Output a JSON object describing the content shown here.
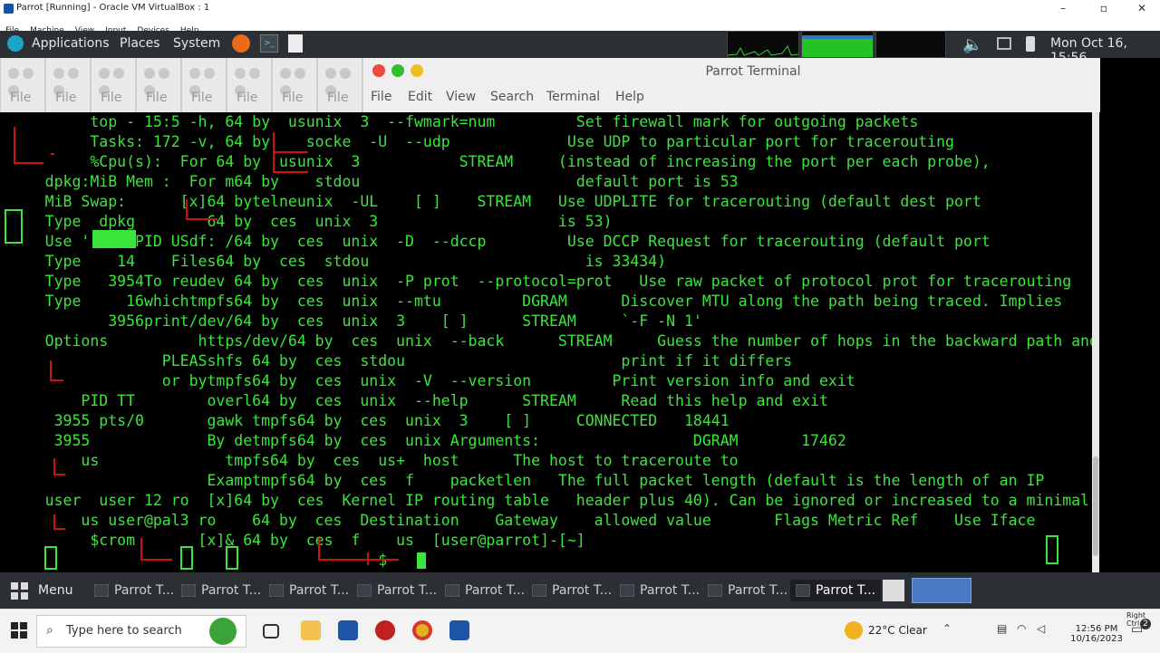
{
  "vbox": {
    "title": "Parrot [Running] - Oracle VM VirtualBox : 1",
    "menu": [
      "File",
      "Machine",
      "View",
      "Input",
      "Devices",
      "Help"
    ]
  },
  "top_panel": {
    "applications": "Applications",
    "places": "Places",
    "system": "System",
    "clock": "Mon Oct 16, 15:56"
  },
  "terminal_window": {
    "title": "Parrot Terminal",
    "menu": [
      "File",
      "Edit",
      "View",
      "Search",
      "Terminal",
      "Help"
    ],
    "background_tab_label": "File"
  },
  "terminal": {
    "lines": [
      {
        "bg": "",
        "fg": "          top - 15:5 -h, 64 by  usunix  3  --fwmark=num         Set firewall mark for outgoing packets"
      },
      {
        "bg": "",
        "fg": "          Tasks: 172 -v, 64 by    socke  -U  --udp             Use UDP to particular port for tracerouting"
      },
      {
        "bg": "",
        "fg": "          %Cpu(s):  For 64 by  usunix  3           STREAM     (instead of increasing the port per each probe),"
      },
      {
        "bg": "",
        "fg": "     dpkg:MiB Mem :  For m64 by    stdou                        default port is 53"
      },
      {
        "bg": "",
        "fg": "     MiB Swap:      [x]64 bytelneunix  -UL    [ ]    STREAM   Use UDPLITE for tracerouting (default dest port"
      },
      {
        "bg": "",
        "fg": "     Type  dpkg        64 by  ces  unix  3                    is 53)"
      },
      {
        "bg": "",
        "fg": "     Use '     PID USdf: /64 by  ces  unix  -D  --dccp         Use DCCP Request for tracerouting (default port"
      },
      {
        "bg": "",
        "fg": "     Type    14    Files64 by  ces  stdou                        is 33434)"
      },
      {
        "bg": "",
        "fg": "     Type   3954To reudev 64 by  ces  unix  -P prot  --protocol=prot   Use raw packet of protocol prot for tracerouting"
      },
      {
        "bg": "",
        "fg": "     Type     16whichtmpfs64 by  ces  unix  --mtu         DGRAM      Discover MTU along the path being traced. Implies"
      },
      {
        "bg": "",
        "fg": "            3956print/dev/64 by  ces  unix  3    [ ]      STREAM     `-F -N 1'"
      },
      {
        "bg": "",
        "fg": "     Options          https/dev/64 by  ces  unix  --back      STREAM     Guess the number of hops in the backward path and"
      },
      {
        "bg": "",
        "fg": "                  PLEASshfs 64 by  ces  stdou                        print if it differs"
      },
      {
        "bg": "",
        "fg": "                  or bytmpfs64 by  ces  unix  -V  --version         Print version info and exit"
      },
      {
        "bg": "",
        "fg": "         PID TT        overl64 by  ces  unix  --help      STREAM     Read this help and exit"
      },
      {
        "bg": "",
        "fg": "      3955 pts/0       gawk tmpfs64 by  ces  unix  3    [ ]     CONNECTED   18441"
      },
      {
        "bg": "",
        "fg": "      3955             By detmpfs64 by  ces  unix Arguments:                 DGRAM       17462"
      },
      {
        "bg": "",
        "fg": "         us              tmpfs64 by  ces  us+  host      The host to traceroute to"
      },
      {
        "bg": "",
        "fg": "                       Examptmpfs64 by  ces  f    packetlen   The full packet length (default is the length of an IP"
      },
      {
        "bg": "",
        "fg": "     user  user 12 ro  [x]64 by  ces  Kernel IP routing table   header plus 40). Can be ignored or increased to a minimal"
      },
      {
        "bg": "",
        "fg": "         us user@pal3 ro    64 by  ces  Destination    Gateway    allowed value       Flags Metric Ref    Use Iface"
      },
      {
        "bg": "",
        "fg": "          $crom       [x]& 64 by  ces  f    us  [user@parrot]-[~]"
      },
      {
        "bg": "",
        "fg": "                                          $"
      }
    ],
    "prompt_user": "user",
    "prompt_host": "parrot",
    "prompt_dir": "~",
    "prompt_symbol": "$"
  },
  "bottom_panel": {
    "menu": "Menu",
    "tasks": [
      "Parrot T...",
      "Parrot T...",
      "Parrot T...",
      "Parrot T...",
      "Parrot T...",
      "Parrot T...",
      "Parrot T...",
      "Parrot T...",
      "Parrot T..."
    ]
  },
  "windows_taskbar": {
    "search_placeholder": "Type here to search",
    "weather": "22°C  Clear",
    "time": "12:56 PM",
    "date": "10/16/2023",
    "host_key": "Right Ctrl",
    "notification_count": "2"
  }
}
